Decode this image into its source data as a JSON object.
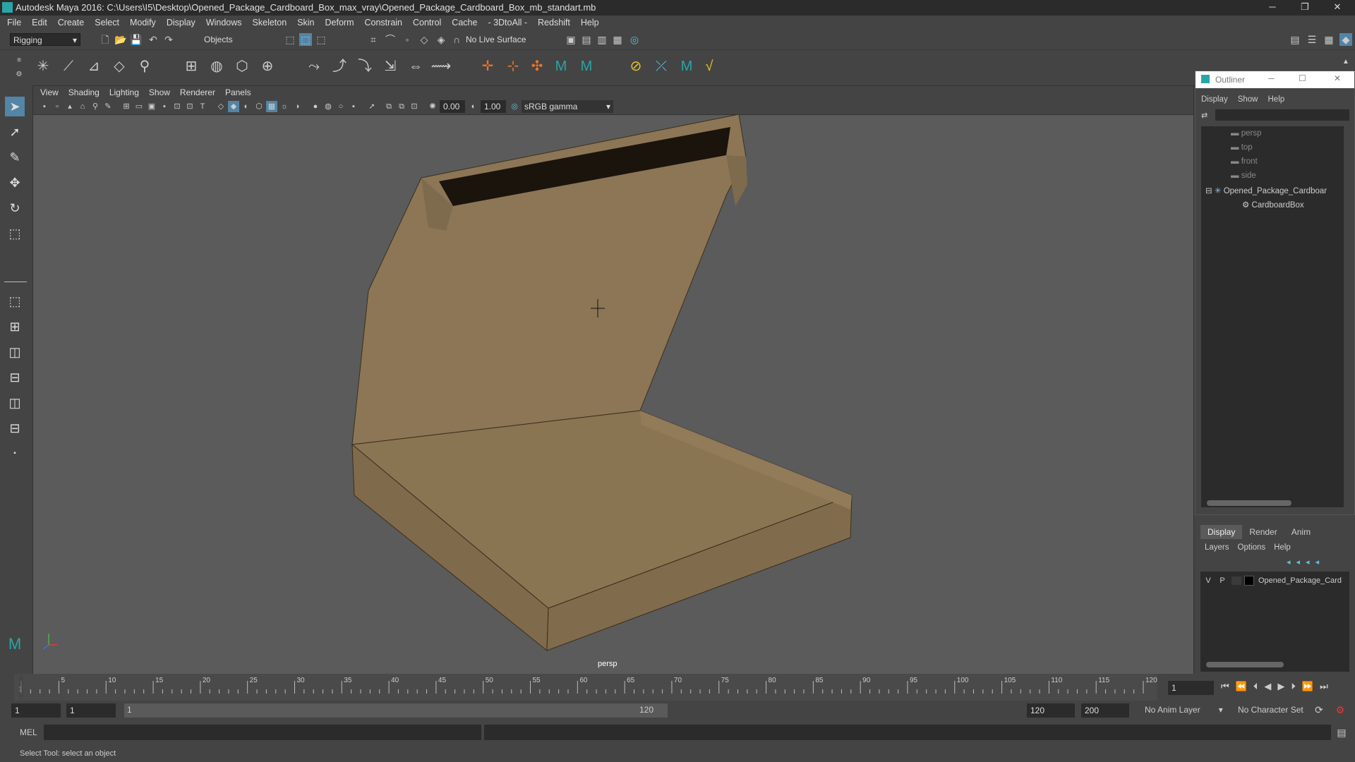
{
  "app": {
    "title": "Autodesk Maya 2016: C:\\Users\\I5\\Desktop\\Opened_Package_Cardboard_Box_max_vray\\Opened_Package_Cardboard_Box_mb_standart.mb"
  },
  "menubar": [
    "File",
    "Edit",
    "Create",
    "Select",
    "Modify",
    "Display",
    "Windows",
    "Skeleton",
    "Skin",
    "Deform",
    "Constrain",
    "Control",
    "Cache",
    "- 3DtoAll -",
    "Redshift",
    "Help"
  ],
  "statusline": {
    "mode": "Rigging",
    "select_mode": "Objects",
    "live_surface": "No Live Surface"
  },
  "viewport": {
    "menu": [
      "View",
      "Shading",
      "Lighting",
      "Show",
      "Renderer",
      "Panels"
    ],
    "exposure": "0.00",
    "gamma": "1.00",
    "color_space": "sRGB gamma",
    "camera_label": "persp"
  },
  "outliner": {
    "title": "Outliner",
    "menu": [
      "Display",
      "Show",
      "Help"
    ],
    "items": [
      {
        "label": "persp",
        "type": "camera"
      },
      {
        "label": "top",
        "type": "camera"
      },
      {
        "label": "front",
        "type": "camera"
      },
      {
        "label": "side",
        "type": "camera"
      },
      {
        "label": "Opened_Package_Cardboar",
        "type": "group"
      },
      {
        "label": "CardboardBox",
        "type": "mesh"
      }
    ]
  },
  "layers": {
    "tabs": [
      "Display",
      "Render",
      "Anim"
    ],
    "menu": [
      "Layers",
      "Options",
      "Help"
    ],
    "row": {
      "v": "V",
      "p": "P",
      "name": "Opened_Package_Card"
    }
  },
  "timeline": {
    "ticks": [
      "1",
      "5",
      "10",
      "15",
      "20",
      "25",
      "30",
      "35",
      "40",
      "45",
      "50",
      "55",
      "60",
      "65",
      "70",
      "75",
      "80",
      "85",
      "90",
      "95",
      "100",
      "105",
      "110",
      "115",
      "120"
    ],
    "current_frame": "1"
  },
  "range": {
    "start": "1",
    "start_inner": "1",
    "slider_start": "1",
    "slider_end": "120",
    "end": "120",
    "end_outer": "200",
    "anim_layer": "No Anim Layer",
    "char_set": "No Character Set"
  },
  "cmd": {
    "label": "MEL"
  },
  "help": {
    "text": "Select Tool: select an object"
  }
}
